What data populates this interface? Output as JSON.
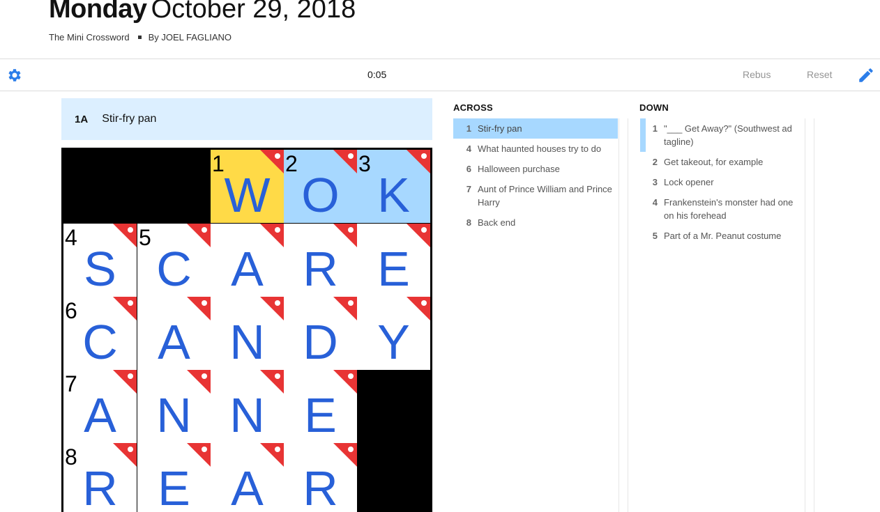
{
  "header": {
    "day": "Monday",
    "date": "October 29, 2018",
    "puzzle_name": "The Mini Crossword",
    "byline": "By JOEL FAGLIANO"
  },
  "toolbar": {
    "timer": "0:05",
    "rebus_label": "Rebus",
    "reset_label": "Reset",
    "settings_icon": "gear-icon",
    "pencil_icon": "pencil-icon"
  },
  "active_clue": {
    "label": "1A",
    "text": "Stir-fry pan"
  },
  "colors": {
    "focus": "#ffda47",
    "word_highlight": "#a7d8ff",
    "clue_bar": "#dcefff",
    "letter": "#2860d8",
    "flag": "#e83434"
  },
  "grid": [
    [
      {
        "black": true
      },
      {
        "black": true
      },
      {
        "num": "1",
        "letter": "W",
        "state": "focus",
        "flag": true
      },
      {
        "num": "2",
        "letter": "O",
        "state": "word",
        "flag": true
      },
      {
        "num": "3",
        "letter": "K",
        "state": "word",
        "flag": true
      }
    ],
    [
      {
        "num": "4",
        "letter": "S",
        "flag": true
      },
      {
        "num": "5",
        "letter": "C",
        "flag": true
      },
      {
        "letter": "A",
        "flag": true
      },
      {
        "letter": "R",
        "flag": true
      },
      {
        "letter": "E",
        "flag": true
      }
    ],
    [
      {
        "num": "6",
        "letter": "C",
        "flag": true
      },
      {
        "letter": "A",
        "flag": true
      },
      {
        "letter": "N",
        "flag": true
      },
      {
        "letter": "D",
        "flag": true
      },
      {
        "letter": "Y",
        "flag": true
      }
    ],
    [
      {
        "num": "7",
        "letter": "A",
        "flag": true
      },
      {
        "letter": "N",
        "flag": true
      },
      {
        "letter": "N",
        "flag": true
      },
      {
        "letter": "E",
        "flag": true
      },
      {
        "black": true
      }
    ],
    [
      {
        "num": "8",
        "letter": "R",
        "flag": true
      },
      {
        "letter": "E",
        "flag": true
      },
      {
        "letter": "A",
        "flag": true
      },
      {
        "letter": "R",
        "flag": true
      },
      {
        "black": true
      }
    ]
  ],
  "across": {
    "title": "ACROSS",
    "clues": [
      {
        "num": "1",
        "text": "Stir-fry pan",
        "selected": true
      },
      {
        "num": "4",
        "text": "What haunted houses try to do"
      },
      {
        "num": "6",
        "text": "Halloween purchase"
      },
      {
        "num": "7",
        "text": "Aunt of Prince William and Prince Harry"
      },
      {
        "num": "8",
        "text": "Back end"
      }
    ]
  },
  "down": {
    "title": "DOWN",
    "clues": [
      {
        "num": "1",
        "text": "\"___ Get Away?\" (Southwest ad tagline)",
        "cross": true
      },
      {
        "num": "2",
        "text": "Get takeout, for example"
      },
      {
        "num": "3",
        "text": "Lock opener"
      },
      {
        "num": "4",
        "text": "Frankenstein's monster had one on his forehead"
      },
      {
        "num": "5",
        "text": "Part of a Mr. Peanut costume"
      }
    ]
  }
}
